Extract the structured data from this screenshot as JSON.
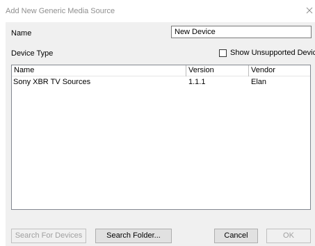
{
  "window": {
    "title": "Add New Generic Media Source"
  },
  "form": {
    "name_label": "Name",
    "name_value": "New Device",
    "device_type_label": "Device Type",
    "show_unsupported_label": "Show Unsupported Devices",
    "show_unsupported_checked": false
  },
  "table": {
    "columns": [
      "Name",
      "Version",
      "Vendor"
    ],
    "rows": [
      {
        "name": "Sony XBR TV Sources",
        "version": "1.1.1",
        "vendor": "Elan"
      }
    ]
  },
  "buttons": {
    "search_devices": "Search For Devices",
    "search_folder": "Search Folder...",
    "cancel": "Cancel",
    "ok": "OK"
  }
}
